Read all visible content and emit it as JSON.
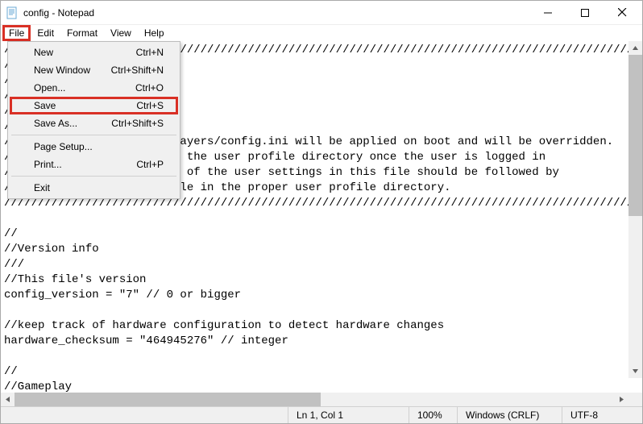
{
  "window": {
    "title": "config - Notepad"
  },
  "menubar": {
    "file": "File",
    "edit": "Edit",
    "format": "Format",
    "view": "View",
    "help": "Help"
  },
  "file_menu": {
    "new": {
      "label": "New",
      "shortcut": "Ctrl+N"
    },
    "new_window": {
      "label": "New Window",
      "shortcut": "Ctrl+Shift+N"
    },
    "open": {
      "label": "Open...",
      "shortcut": "Ctrl+O"
    },
    "save": {
      "label": "Save",
      "shortcut": "Ctrl+S"
    },
    "save_as": {
      "label": "Save As...",
      "shortcut": "Ctrl+Shift+S"
    },
    "page_setup": {
      "label": "Page Setup...",
      "shortcut": ""
    },
    "print": {
      "label": "Print...",
      "shortcut": "Ctrl+P"
    },
    "exit": {
      "label": "Exit",
      "shortcut": ""
    }
  },
  "editor": {
    "content": "///////////////////////////////////////////////////////////////////////////////////////////////////\n//\n//Config File\n//Location: config.ini\n//\n///\n//The settings found in players/config.ini will be applied on boot and will be overridden.\n//by any settings found in the user profile directory once the user is logged in\n//Because of this, edition of the user settings in this file should be followed by\n//a copy of this config file in the proper user profile directory.\n///////////////////////////////////////////////////////////////////////////////////////////////////\n\n//\n//Version info\n///\n//This file's version\nconfig_version = \"7\" // 0 or bigger\n\n//keep track of hardware configuration to detect hardware changes\nhardware_checksum = \"464945276\" // integer\n\n//\n//Gameplay"
  },
  "statusbar": {
    "position": "Ln 1, Col 1",
    "zoom": "100%",
    "line_ending": "Windows (CRLF)",
    "encoding": "UTF-8"
  },
  "highlights": {
    "file_menu_button": true,
    "save_menu_item": true
  }
}
